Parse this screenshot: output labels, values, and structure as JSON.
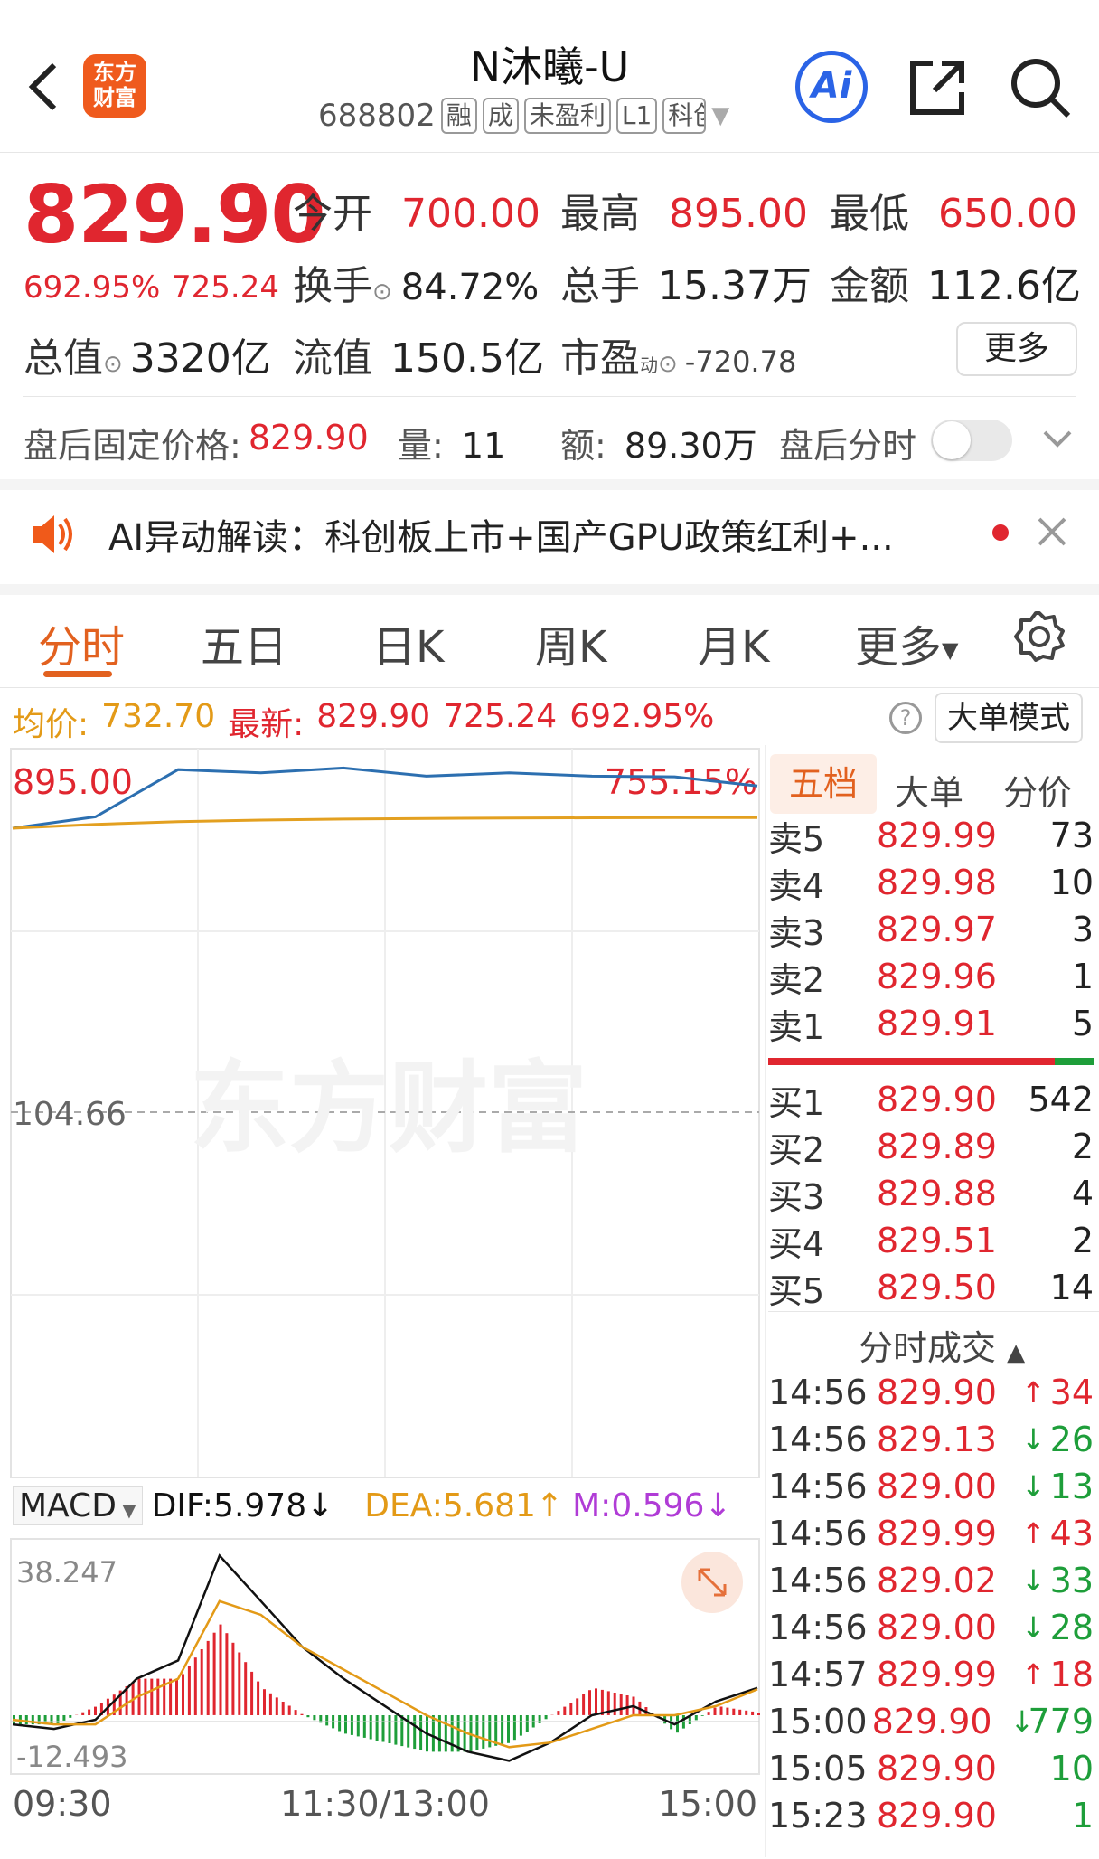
{
  "header": {
    "title": "N沐曦-U",
    "code": "688802",
    "tags": [
      "融",
      "成",
      "未盈利",
      "L1"
    ],
    "market_tag": "科创",
    "logo_line1": "东方",
    "logo_line2": "财富",
    "ai_label": "Ai"
  },
  "quote": {
    "price": "829.90",
    "change_pct": "692.95%",
    "change_amt": "725.24",
    "open_label": "今开",
    "open": "700.00",
    "high_label": "最高",
    "high": "895.00",
    "low_label": "最低",
    "low": "650.00",
    "turnover_label": "换手",
    "turnover": "84.72%",
    "volume_label": "总手",
    "volume": "15.37万",
    "amount_label": "金额",
    "amount": "112.6亿",
    "mktcap_label": "总值",
    "mktcap": "3320亿",
    "float_label": "流值",
    "float_cap": "150.5亿",
    "pe_label": "市盈",
    "pe_sup": "动",
    "pe": "-720.78",
    "more_label": "更多"
  },
  "after_hours": {
    "price_label": "盘后固定价格:",
    "price": "829.90",
    "vol_label": "量:",
    "vol": "11",
    "amt_label": "额:",
    "amt": "89.30万",
    "toggle_label": "盘后分时"
  },
  "ai_banner": {
    "text": "AI异动解读：科创板上市+国产GPU政策红利+..."
  },
  "tabs": [
    "分时",
    "五日",
    "日K",
    "周K",
    "月K",
    "更多"
  ],
  "info_bar": {
    "avg_label": "均价:",
    "avg": "732.70",
    "latest_label": "最新:",
    "latest": "829.90",
    "latest_chg": "725.24",
    "latest_pct": "692.95%",
    "big_order_btn": "大单模式"
  },
  "chart_labels": {
    "top_price": "895.00",
    "top_pct": "755.15%",
    "mid_price": "104.66",
    "watermark": "东方财富",
    "macd_selector": "MACD",
    "dif": "DIF:5.978",
    "dea": "DEA:5.681",
    "m": "M:0.596",
    "macd_top": "38.247",
    "macd_bottom": "-12.493",
    "time_start": "09:30",
    "time_mid": "11:30/13:00",
    "time_end": "15:00"
  },
  "chart_data": [
    {
      "type": "line",
      "x": [
        "09:30",
        "11:30/13:00",
        "15:00"
      ],
      "series": [
        {
          "name": "最新",
          "values": [
            700,
            735,
            880,
            870,
            885,
            860,
            870,
            860,
            858,
            829.9
          ]
        },
        {
          "name": "均价",
          "values": [
            700,
            712,
            720,
            725,
            728,
            730,
            731,
            732,
            732.5,
            732.7
          ]
        }
      ],
      "ylim": [
        104.66,
        895.0
      ]
    },
    {
      "type": "bar",
      "title": "MACD",
      "series": [
        {
          "name": "DIF",
          "values": [
            -2,
            -3,
            -1,
            8,
            12,
            35,
            25,
            15,
            8,
            2,
            -4,
            -8,
            -10,
            -6,
            0,
            2,
            -2,
            3,
            5.978
          ]
        },
        {
          "name": "DEA",
          "values": [
            -1,
            -2,
            -2,
            4,
            8,
            25,
            22,
            15,
            10,
            5,
            0,
            -4,
            -7,
            -6,
            -3,
            0,
            0,
            2,
            5.681
          ]
        }
      ],
      "ylim": [
        -12.493,
        38.247
      ]
    }
  ],
  "orderbook": {
    "tabs": [
      "五档",
      "大单",
      "分价"
    ],
    "asks": [
      {
        "label": "卖5",
        "price": "829.99",
        "vol": "73"
      },
      {
        "label": "卖4",
        "price": "829.98",
        "vol": "10"
      },
      {
        "label": "卖3",
        "price": "829.97",
        "vol": "3"
      },
      {
        "label": "卖2",
        "price": "829.96",
        "vol": "1"
      },
      {
        "label": "卖1",
        "price": "829.91",
        "vol": "5"
      }
    ],
    "bids": [
      {
        "label": "买1",
        "price": "829.90",
        "vol": "542"
      },
      {
        "label": "买2",
        "price": "829.89",
        "vol": "2"
      },
      {
        "label": "买3",
        "price": "829.88",
        "vol": "4"
      },
      {
        "label": "买4",
        "price": "829.51",
        "vol": "2"
      },
      {
        "label": "买5",
        "price": "829.50",
        "vol": "14"
      }
    ]
  },
  "trades": {
    "title": "分时成交",
    "rows": [
      {
        "time": "14:56",
        "price": "829.90",
        "dir": "up",
        "vol": "34"
      },
      {
        "time": "14:56",
        "price": "829.13",
        "dir": "down",
        "vol": "26"
      },
      {
        "time": "14:56",
        "price": "829.00",
        "dir": "down",
        "vol": "13"
      },
      {
        "time": "14:56",
        "price": "829.99",
        "dir": "up",
        "vol": "43"
      },
      {
        "time": "14:56",
        "price": "829.02",
        "dir": "down",
        "vol": "33"
      },
      {
        "time": "14:56",
        "price": "829.00",
        "dir": "down",
        "vol": "28"
      },
      {
        "time": "14:57",
        "price": "829.99",
        "dir": "up",
        "vol": "18"
      },
      {
        "time": "15:00",
        "price": "829.90",
        "dir": "down",
        "vol": "779"
      },
      {
        "time": "15:05",
        "price": "829.90",
        "dir": "",
        "vol": "10"
      },
      {
        "time": "15:23",
        "price": "829.90",
        "dir": "",
        "vol": "1"
      }
    ]
  }
}
